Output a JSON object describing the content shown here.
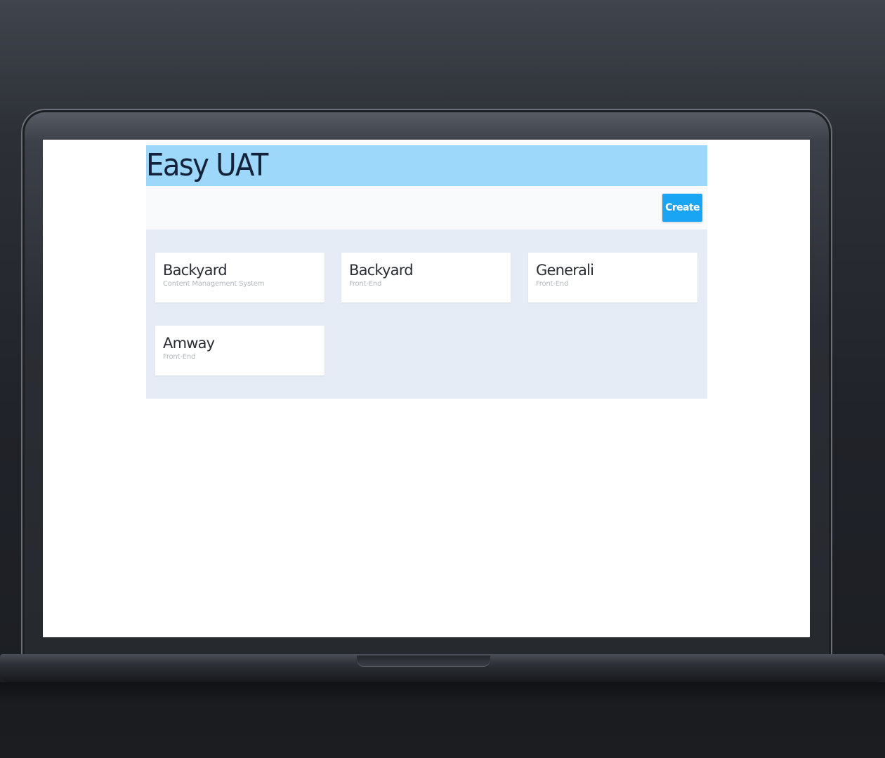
{
  "app": {
    "title": "Easy UAT"
  },
  "toolbar": {
    "create_label": "Create"
  },
  "projects": [
    {
      "name": "Backyard",
      "type": "Content Management System"
    },
    {
      "name": "Backyard",
      "type": "Front-End"
    },
    {
      "name": "Generali",
      "type": "Front-End"
    },
    {
      "name": "Amway",
      "type": "Front-End"
    }
  ],
  "colors": {
    "header_bg": "#9dd8fb",
    "accent": "#1aa4f4",
    "panel_bg": "#e6ecf5",
    "title_text": "#15233a"
  }
}
